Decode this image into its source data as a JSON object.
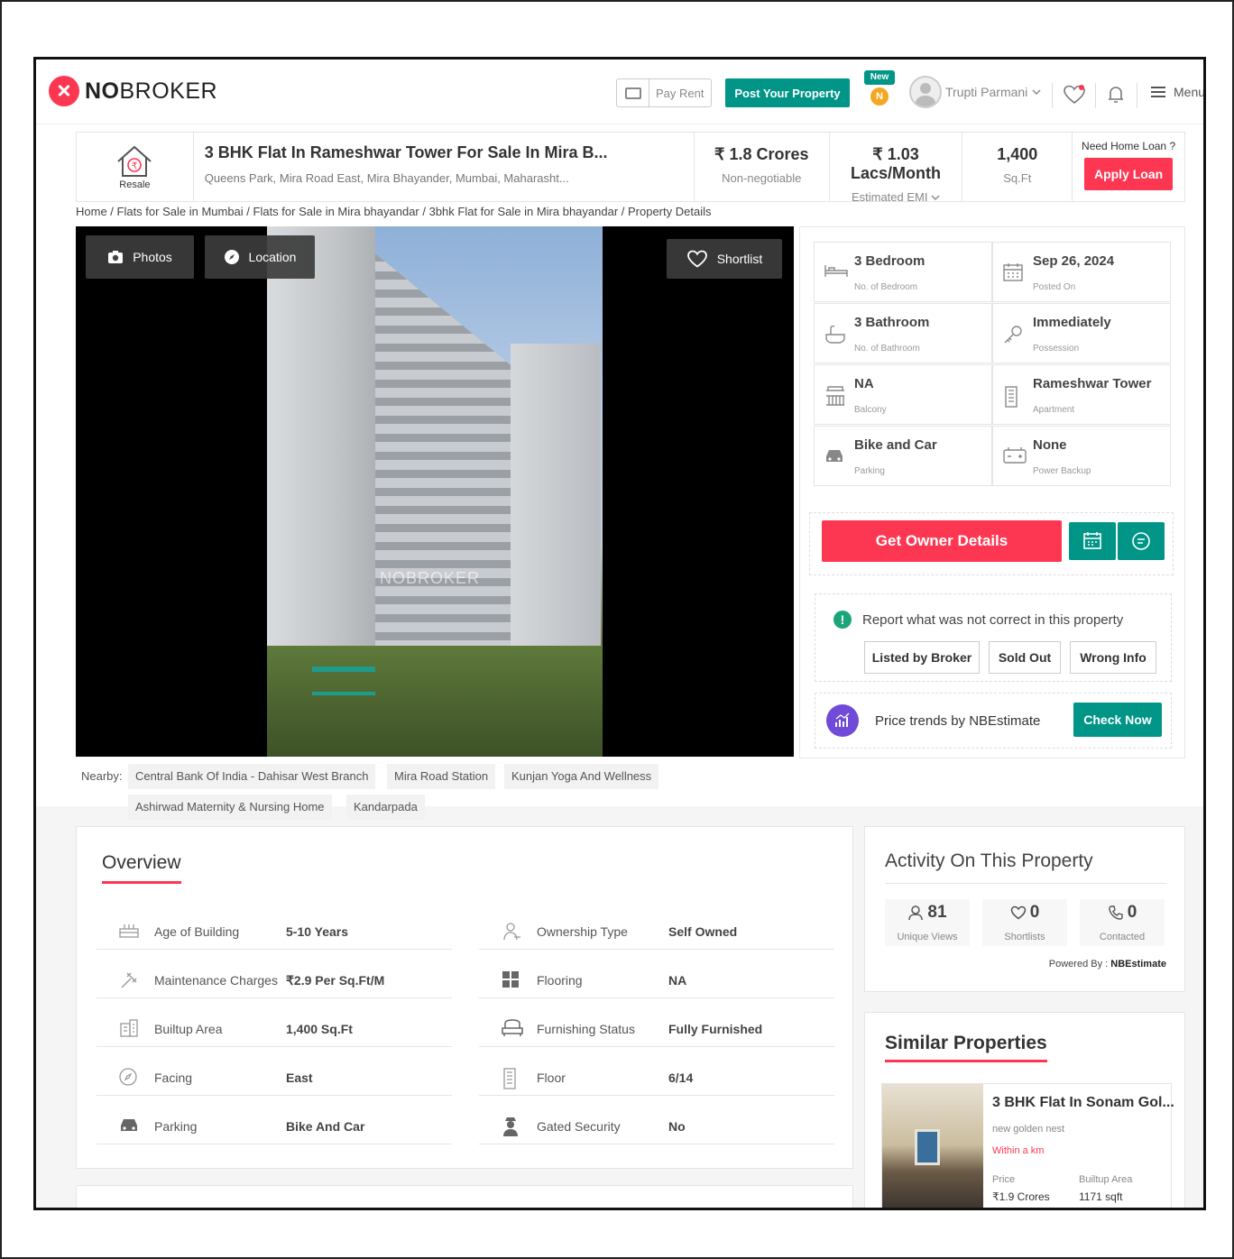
{
  "header": {
    "logo_bold": "NO",
    "logo_rest": "BROKER",
    "pay_rent": "Pay Rent",
    "post_property": "Post Your Property",
    "new_badge": "New",
    "n_badge": "N",
    "user_name": "Trupti Parmani",
    "menu": "Menu"
  },
  "listing": {
    "resale": "Resale",
    "title": "3 BHK Flat In Rameshwar Tower For Sale In Mira B...",
    "address": "Queens Park, Mira Road East, Mira Bhayander, Mumbai, Maharasht...",
    "price": "₹ 1.8 Crores",
    "price_note": "Non-negotiable",
    "emi": "₹ 1.03 Lacs/Month",
    "emi_note": "Estimated EMI",
    "area": "1,400",
    "area_unit": "Sq.Ft",
    "loan_q": "Need Home Loan ?",
    "apply_loan": "Apply Loan"
  },
  "breadcrumb": "Home / Flats for Sale in Mumbai / Flats for Sale in Mira bhayandar / 3bhk Flat for Sale in Mira bhayandar / Property Details",
  "gallery": {
    "photos": "Photos",
    "location": "Location",
    "shortlist": "Shortlist",
    "watermark": "NOBROKER"
  },
  "nearby": {
    "label": "Nearby:",
    "items": [
      "Central Bank Of India - Dahisar West Branch",
      "Mira Road Station",
      "Kunjan Yoga And Wellness",
      "Ashirwad Maternity & Nursing Home",
      "Kandarpada"
    ]
  },
  "specs": [
    {
      "value": "3 Bedroom",
      "label": "No. of Bedroom",
      "icon": "bed-icon"
    },
    {
      "value": "Sep 26, 2024",
      "label": "Posted On",
      "icon": "calendar-icon"
    },
    {
      "value": "3 Bathroom",
      "label": "No. of Bathroom",
      "icon": "bath-icon"
    },
    {
      "value": "Immediately",
      "label": "Possession",
      "icon": "key-icon"
    },
    {
      "value": "NA",
      "label": "Balcony",
      "icon": "balcony-icon"
    },
    {
      "value": "Rameshwar Tower",
      "label": "Apartment",
      "icon": "building-icon"
    },
    {
      "value": "Bike and Car",
      "label": "Parking",
      "icon": "car-icon"
    },
    {
      "value": "None",
      "label": "Power Backup",
      "icon": "battery-icon"
    }
  ],
  "actions": {
    "get_owner": "Get Owner Details",
    "report_text": "Report what was not correct in this property",
    "report_buttons": [
      "Listed by Broker",
      "Sold Out",
      "Wrong Info"
    ],
    "trend_text": "Price trends by NBEstimate",
    "check_now": "Check Now"
  },
  "overview": {
    "title": "Overview",
    "left": [
      {
        "label": "Age of Building",
        "value": "5-10 Years"
      },
      {
        "label": "Maintenance Charges",
        "value": "₹2.9 Per Sq.Ft/M"
      },
      {
        "label": "Builtup Area",
        "value": "1,400 Sq.Ft"
      },
      {
        "label": "Facing",
        "value": "East"
      },
      {
        "label": "Parking",
        "value": "Bike And Car"
      }
    ],
    "right": [
      {
        "label": "Ownership Type",
        "value": "Self Owned"
      },
      {
        "label": "Flooring",
        "value": "NA"
      },
      {
        "label": "Furnishing Status",
        "value": "Fully Furnished"
      },
      {
        "label": "Floor",
        "value": "6/14"
      },
      {
        "label": "Gated Security",
        "value": "No"
      }
    ]
  },
  "activity": {
    "title": "Activity On This Property",
    "views": "81",
    "views_label": "Unique Views",
    "shortlists": "0",
    "shortlists_label": "Shortlists",
    "contacted": "0",
    "contacted_label": "Contacted",
    "powered_label": "Powered By :",
    "powered_by": "NBEstimate"
  },
  "similar": {
    "title": "Similar Properties",
    "card_title": "3 BHK Flat In Sonam Gol...",
    "card_sub": "new golden nest",
    "card_distance": "Within a km",
    "price_label": "Price",
    "price_value": "₹1.9 Crores",
    "area_label": "Builtup Area",
    "area_value": "1171 sqft"
  }
}
